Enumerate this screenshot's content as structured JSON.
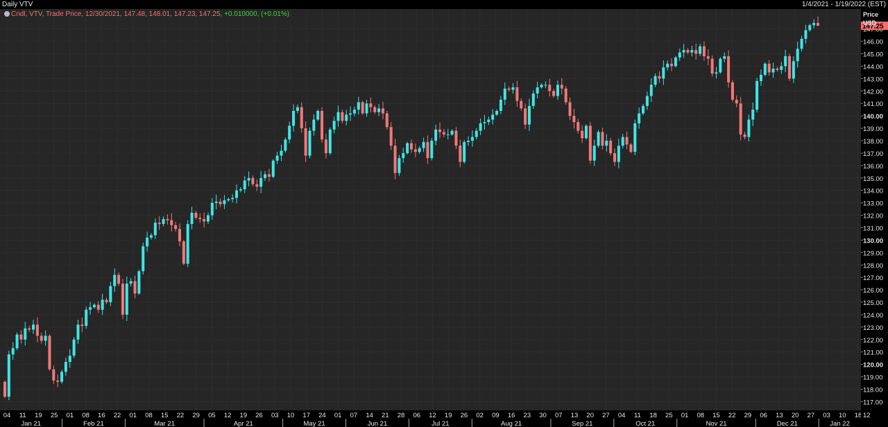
{
  "header": {
    "title": "Daily VTV",
    "date_range": "1/4/2021 - 1/19/2022 (EST)"
  },
  "legend": {
    "prefix": "Cndl, VTV, Trade Price, 12/30/2021, 147.48, 148.01, 147.23, 147.25,",
    "change": "+0.010000, (+0.01%)"
  },
  "axis": {
    "title": "Price",
    "unit": "USD",
    "last_price": "147.25",
    "last_price_color": "#ff6b6b"
  },
  "colors": {
    "up": "#3ee6e6",
    "down": "#f07878",
    "background": "#262626",
    "grid": "#3a3a3a"
  },
  "chart_data": {
    "type": "candlestick",
    "symbol": "VTV",
    "ylim": [
      116.3,
      148.6
    ],
    "y_ticks": [
      117,
      118,
      119,
      120,
      121,
      122,
      123,
      124,
      125,
      126,
      127,
      128,
      129,
      130,
      131,
      132,
      133,
      134,
      135,
      136,
      137,
      138,
      139,
      140,
      141,
      142,
      143,
      144,
      145,
      146,
      147
    ],
    "y_tick_labels": [
      "117.00",
      "118.00",
      "119.00",
      "120.00",
      "121.00",
      "122.00",
      "123.00",
      "124.00",
      "125.00",
      "126.00",
      "127.00",
      "128.00",
      "129.00",
      "130.00",
      "131.00",
      "132.00",
      "133.00",
      "134.00",
      "135.00",
      "136.00",
      "137.00",
      "138.00",
      "139.00",
      "140.00",
      "141.00",
      "142.00",
      "143.00",
      "144.00",
      "145.00",
      "146.00",
      "147.00"
    ],
    "y_bold": [
      "120.00",
      "130.00",
      "140.00"
    ],
    "y_bottom_label": "12",
    "x_day_ticks": [
      "04",
      "11",
      "19",
      "25",
      "01",
      "08",
      "16",
      "22",
      "01",
      "08",
      "15",
      "22",
      "29",
      "05",
      "12",
      "19",
      "26",
      "03",
      "10",
      "17",
      "24",
      "01",
      "07",
      "14",
      "21",
      "28",
      "06",
      "12",
      "19",
      "26",
      "02",
      "09",
      "16",
      "23",
      "30",
      "07",
      "13",
      "20",
      "27",
      "04",
      "11",
      "18",
      "25",
      "01",
      "08",
      "15",
      "22",
      "29",
      "06",
      "13",
      "20",
      "27",
      "03",
      "10",
      "18"
    ],
    "x_month_labels": [
      "Jan 21",
      "Feb 21",
      "Mar 21",
      "Apr 21",
      "May 21",
      "Jun 21",
      "Jul 21",
      "Aug 21",
      "Sep 21",
      "Oct 21",
      "Nov 21",
      "Dec 21",
      "Jan 22"
    ],
    "last_candle": {
      "date": "12/30/2021",
      "open": 147.48,
      "high": 148.01,
      "low": 147.23,
      "close": 147.25
    },
    "closes": [
      117.4,
      120.8,
      121.3,
      122.4,
      122.0,
      122.9,
      122.8,
      123.2,
      122.3,
      121.9,
      122.3,
      119.6,
      118.7,
      118.6,
      119.4,
      120.2,
      120.7,
      122.0,
      123.2,
      123.1,
      124.4,
      124.6,
      124.8,
      124.4,
      125.2,
      125.0,
      126.3,
      127.2,
      126.5,
      124.0,
      126.5,
      126.7,
      125.7,
      127.5,
      129.5,
      130.2,
      130.4,
      131.4,
      131.3,
      131.7,
      131.6,
      131.2,
      130.9,
      129.9,
      128.1,
      131.3,
      132.2,
      131.8,
      131.7,
      131.5,
      132.0,
      133.0,
      133.1,
      132.9,
      133.2,
      133.3,
      133.4,
      134.0,
      134.1,
      134.8,
      135.0,
      134.5,
      134.3,
      135.0,
      135.3,
      135.1,
      136.4,
      136.8,
      137.2,
      138.1,
      139.2,
      140.4,
      140.7,
      139.0,
      136.8,
      138.8,
      139.7,
      140.4,
      138.1,
      137.0,
      138.9,
      139.6,
      140.3,
      139.6,
      140.1,
      140.2,
      140.5,
      141.1,
      140.2,
      141.0,
      140.7,
      140.3,
      140.6,
      140.2,
      139.1,
      137.6,
      135.4,
      136.6,
      137.0,
      137.8,
      137.3,
      137.1,
      137.4,
      137.9,
      136.6,
      138.0,
      138.9,
      138.7,
      138.5,
      138.5,
      138.8,
      137.6,
      136.3,
      137.9,
      138.0,
      138.3,
      138.8,
      139.4,
      139.5,
      139.7,
      140.1,
      140.4,
      141.3,
      142.2,
      142.1,
      142.3,
      141.2,
      140.6,
      139.3,
      140.8,
      141.8,
      142.3,
      142.5,
      142.5,
      142.0,
      141.6,
      142.5,
      142.2,
      141.1,
      140.0,
      139.5,
      138.8,
      138.2,
      139.2,
      136.4,
      137.6,
      138.7,
      137.6,
      138.0,
      137.0,
      136.3,
      137.6,
      138.3,
      137.7,
      137.1,
      139.4,
      140.2,
      140.8,
      141.6,
      142.5,
      143.2,
      143.0,
      143.9,
      144.2,
      144.0,
      144.7,
      145.1,
      145.3,
      145.1,
      145.3,
      145.0,
      145.6,
      144.8,
      144.6,
      143.4,
      143.5,
      144.6,
      144.8,
      142.7,
      141.3,
      141.0,
      138.5,
      138.3,
      139.7,
      140.5,
      142.8,
      143.3,
      144.2,
      143.5,
      143.8,
      143.7,
      144.0,
      144.8,
      143.0,
      144.4,
      145.4,
      146.2,
      146.9,
      147.3,
      147.48,
      147.25
    ]
  }
}
